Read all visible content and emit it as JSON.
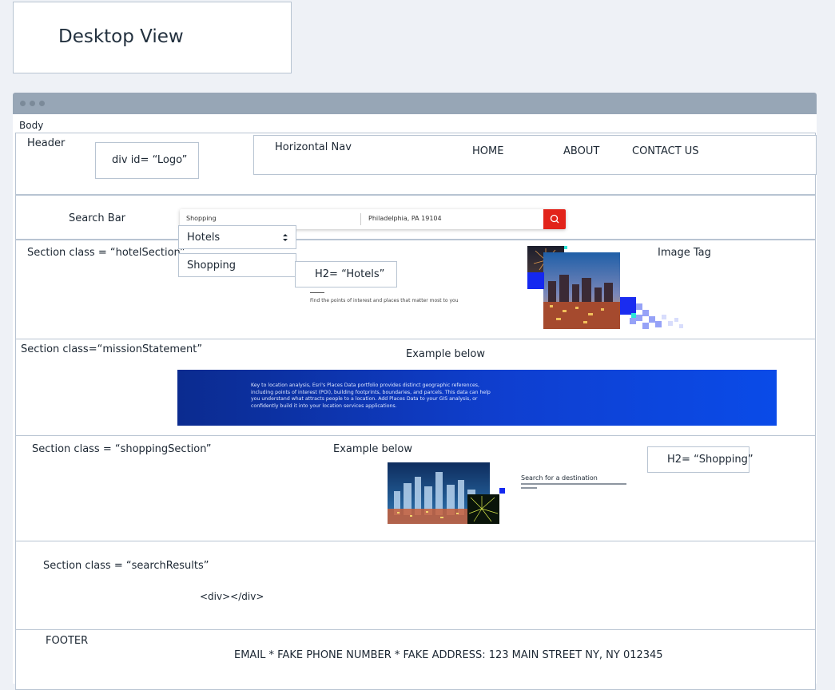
{
  "title_card": {
    "title": "Desktop View"
  },
  "body_label": "Body",
  "header": {
    "label": "Header",
    "logo_box": "div id= “Logo”",
    "nav_label": "Horizontal Nav",
    "nav_items": [
      "HOME",
      "ABOUT",
      "CONTACT US"
    ]
  },
  "search_bar": {
    "label": "Search Bar",
    "what_value": "Shopping",
    "where_value": "Philadelphia, PA 19104",
    "dropdown_selected": "Hotels",
    "dropdown_option": "Shopping"
  },
  "hotel_section": {
    "label": "Section class = “hotelSection”",
    "h2_box": "H2= “Hotels”",
    "caption": "Find the points of interest and places that matter most to you",
    "image_label": "Image Tag"
  },
  "mission_section": {
    "label": "Section class=“missionStatement”",
    "example_label": "Example below",
    "banner_text": "Key to location analysis, Esri's Places Data portfolio provides distinct geographic references, including points of interest (POI), building footprints, boundaries, and parcels. This data can help you understand what attracts people to a location. Add Places Data to your GIS analysis, or confidently build it into your location services applications."
  },
  "shopping_section": {
    "label": "Section class = “shoppingSection”",
    "example_label": "Example below",
    "h2_box": "H2= “Shopping”",
    "card_title": "Search for a destination"
  },
  "results_section": {
    "label": "Section class = “searchResults”",
    "div_text": "<div></div>"
  },
  "footer": {
    "label": "FOOTER",
    "text": "EMAIL *  FAKE PHONE NUMBER * FAKE ADDRESS: 123 MAIN STREET NY, NY 012345"
  },
  "colors": {
    "banner": "#0f3fd0",
    "search_button": "#e2231a",
    "frame": "#97a6b6"
  },
  "icons": [
    "search-icon",
    "select-arrows-icon"
  ]
}
